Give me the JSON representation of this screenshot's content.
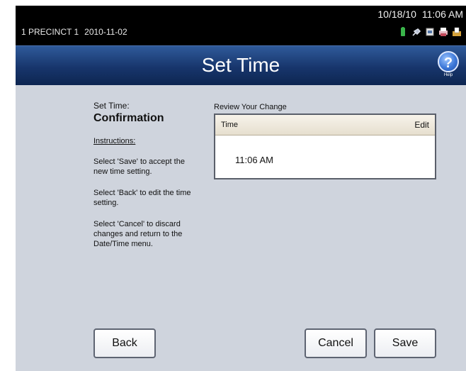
{
  "header": {
    "precinct": "1 PRECINCT 1",
    "election_date": "2010-11-02",
    "current_date": "10/18/10",
    "current_time": "11:06 AM",
    "status_icons": [
      "battery-icon",
      "power-plug-icon",
      "memory-card-icon",
      "printer-icon",
      "ballot-box-icon"
    ]
  },
  "titlebar": {
    "title": "Set Time",
    "help_label": "Help",
    "help_glyph": "?"
  },
  "instructions_panel": {
    "step_label": "Set Time:",
    "step_title": "Confirmation",
    "heading": "Instructions:",
    "items": [
      "Select 'Save' to accept the new time setting.",
      "Select 'Back' to edit the time setting.",
      "Select 'Cancel' to discard changes and return to the Date/Time menu."
    ]
  },
  "review": {
    "label": "Review Your Change",
    "columns": {
      "time": "Time",
      "edit": "Edit"
    },
    "value": "11:06 AM"
  },
  "buttons": {
    "back": "Back",
    "cancel": "Cancel",
    "save": "Save"
  },
  "colors": {
    "titlebar": "#17356b",
    "content_bg": "#cfd4dd",
    "topbar": "#000000"
  }
}
